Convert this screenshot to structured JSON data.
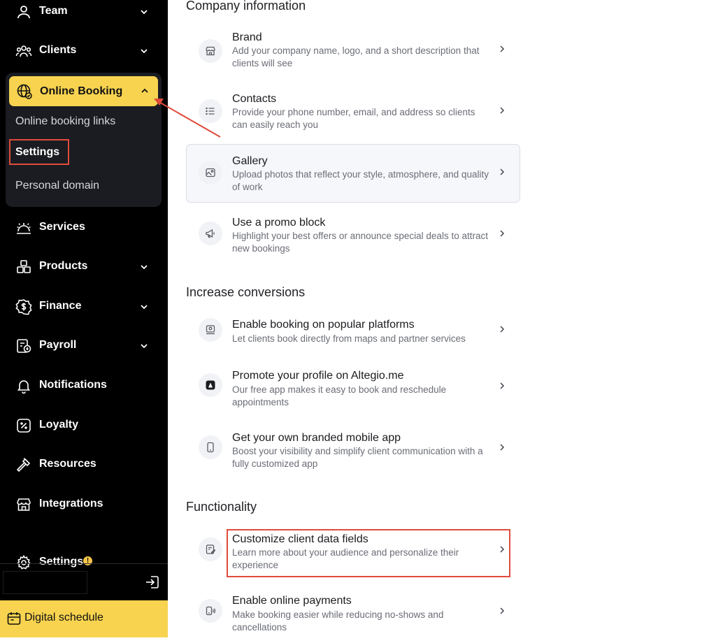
{
  "sidebar": {
    "items": [
      {
        "label": "Team",
        "icon": "person-icon",
        "has_chevron": true
      },
      {
        "label": "Clients",
        "icon": "clients-icon",
        "has_chevron": true
      },
      {
        "label": "Online Booking",
        "icon": "globe-icon",
        "expanded": true
      },
      {
        "label": "Services",
        "icon": "service-bell-icon"
      },
      {
        "label": "Products",
        "icon": "boxes-icon",
        "has_chevron": true
      },
      {
        "label": "Finance",
        "icon": "dollar-badge-icon",
        "has_chevron": true
      },
      {
        "label": "Payroll",
        "icon": "payroll-icon",
        "has_chevron": true
      },
      {
        "label": "Notifications",
        "icon": "bell-icon"
      },
      {
        "label": "Loyalty",
        "icon": "percent-icon"
      },
      {
        "label": "Resources",
        "icon": "hammer-icon"
      },
      {
        "label": "Integrations",
        "icon": "store-icon"
      },
      {
        "label": "Settings",
        "icon": "gear-icon",
        "badge": "!"
      }
    ],
    "online_booking_sub": [
      {
        "label": "Online booking links"
      },
      {
        "label": "Settings",
        "selected": true
      },
      {
        "label": "Personal domain"
      }
    ],
    "digital_schedule": "Digital schedule"
  },
  "main": {
    "sections": [
      {
        "title": "Company information",
        "cards": [
          {
            "title": "Brand",
            "desc": "Add your company name, logo, and a short description that clients will see",
            "icon": "storefront-icon"
          },
          {
            "title": "Contacts",
            "desc": "Provide your phone number, email, and address so clients can easily reach you",
            "icon": "list-icon"
          },
          {
            "title": "Gallery",
            "desc": "Upload photos that reflect your style, atmosphere, and quality of work",
            "icon": "image-icon"
          },
          {
            "title": "Use a promo block",
            "desc": "Highlight your best offers or announce special deals to attract new bookings",
            "icon": "megaphone-icon"
          }
        ]
      },
      {
        "title": "Increase conversions",
        "cards": [
          {
            "title": "Enable booking on popular platforms",
            "desc": "Let clients book directly from maps and partner services",
            "icon": "platforms-icon"
          },
          {
            "title": "Promote your profile on Altegio.me",
            "desc": "Our free app makes it easy to book and reschedule appointments",
            "icon": "altegio-logo-icon"
          },
          {
            "title": "Get your own branded mobile app",
            "desc": "Boost your visibility and simplify client communication with a fully customized app",
            "icon": "smartphone-icon"
          }
        ]
      },
      {
        "title": "Functionality",
        "cards": [
          {
            "title": "Customize client data fields",
            "desc": "Learn more about your audience and personalize their experience",
            "icon": "edit-form-icon"
          },
          {
            "title": "Enable online payments",
            "desc": "Make booking easier while reducing no-shows and cancellations",
            "icon": "contactless-payment-icon"
          }
        ]
      }
    ]
  },
  "colors": {
    "sidebar_bg": "#000000",
    "accent_yellow": "#f7d34f",
    "annotation_red": "#e04b3b"
  }
}
